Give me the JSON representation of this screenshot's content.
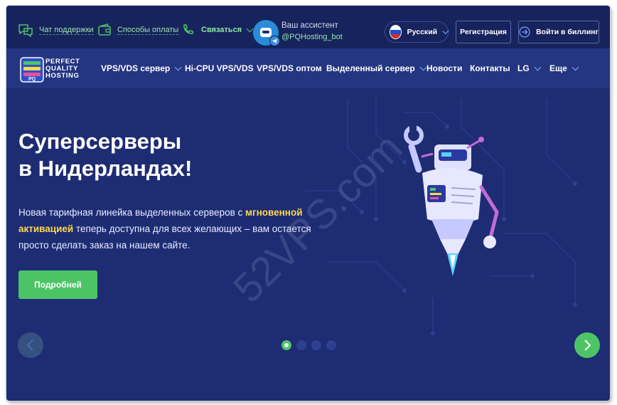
{
  "topbar": {
    "support_chat": "Чат поддержки",
    "payment_methods": "Способы оплаты",
    "contact": "Связаться",
    "assistant_title": "Ваш ассистент",
    "assistant_handle": "@PQHosting_bot",
    "language": "Русский",
    "register": "Регистрация",
    "billing_login": "Войти в биллинг"
  },
  "logo": {
    "line1": "PERFECT",
    "line2": "QUALITY",
    "line3": "HOSTING"
  },
  "nav": {
    "items": [
      {
        "label": "VPS/VDS сервер",
        "dropdown": true
      },
      {
        "label": "Hi-CPU VPS/VDS",
        "dropdown": false
      },
      {
        "label": "VPS/VDS оптом",
        "dropdown": false
      },
      {
        "label": "Выделенный сервер",
        "dropdown": true
      },
      {
        "label": "Новости",
        "dropdown": false
      },
      {
        "label": "Контакты",
        "dropdown": false
      },
      {
        "label": "LG",
        "dropdown": true
      },
      {
        "label": "Еще",
        "dropdown": true
      }
    ]
  },
  "hero": {
    "title_line1": "Суперсерверы",
    "title_line2": "в Нидерландах!",
    "text_part1": "Новая тарифная линейка выделенных серверов с ",
    "text_highlight1": "мгновенной",
    "text_highlight2": "активацией",
    "text_part2": " теперь доступна для всех желающих – вам остается просто сделать заказ на нашем сайте.",
    "cta": "Подробней",
    "slides_count": 4,
    "active_slide": 1
  },
  "watermark": "52VPS.com",
  "colors": {
    "background": "#1e2c73",
    "topbar": "#17235c",
    "nav": "#243581",
    "accent_green": "#4cc466",
    "highlight_yellow": "#ffd94a"
  },
  "icons": [
    "chat-icon",
    "wallet-icon",
    "phone-icon",
    "telegram-icon",
    "russia-flag-icon",
    "login-icon",
    "chevron-down-icon",
    "arrow-left-icon",
    "arrow-right-icon"
  ]
}
